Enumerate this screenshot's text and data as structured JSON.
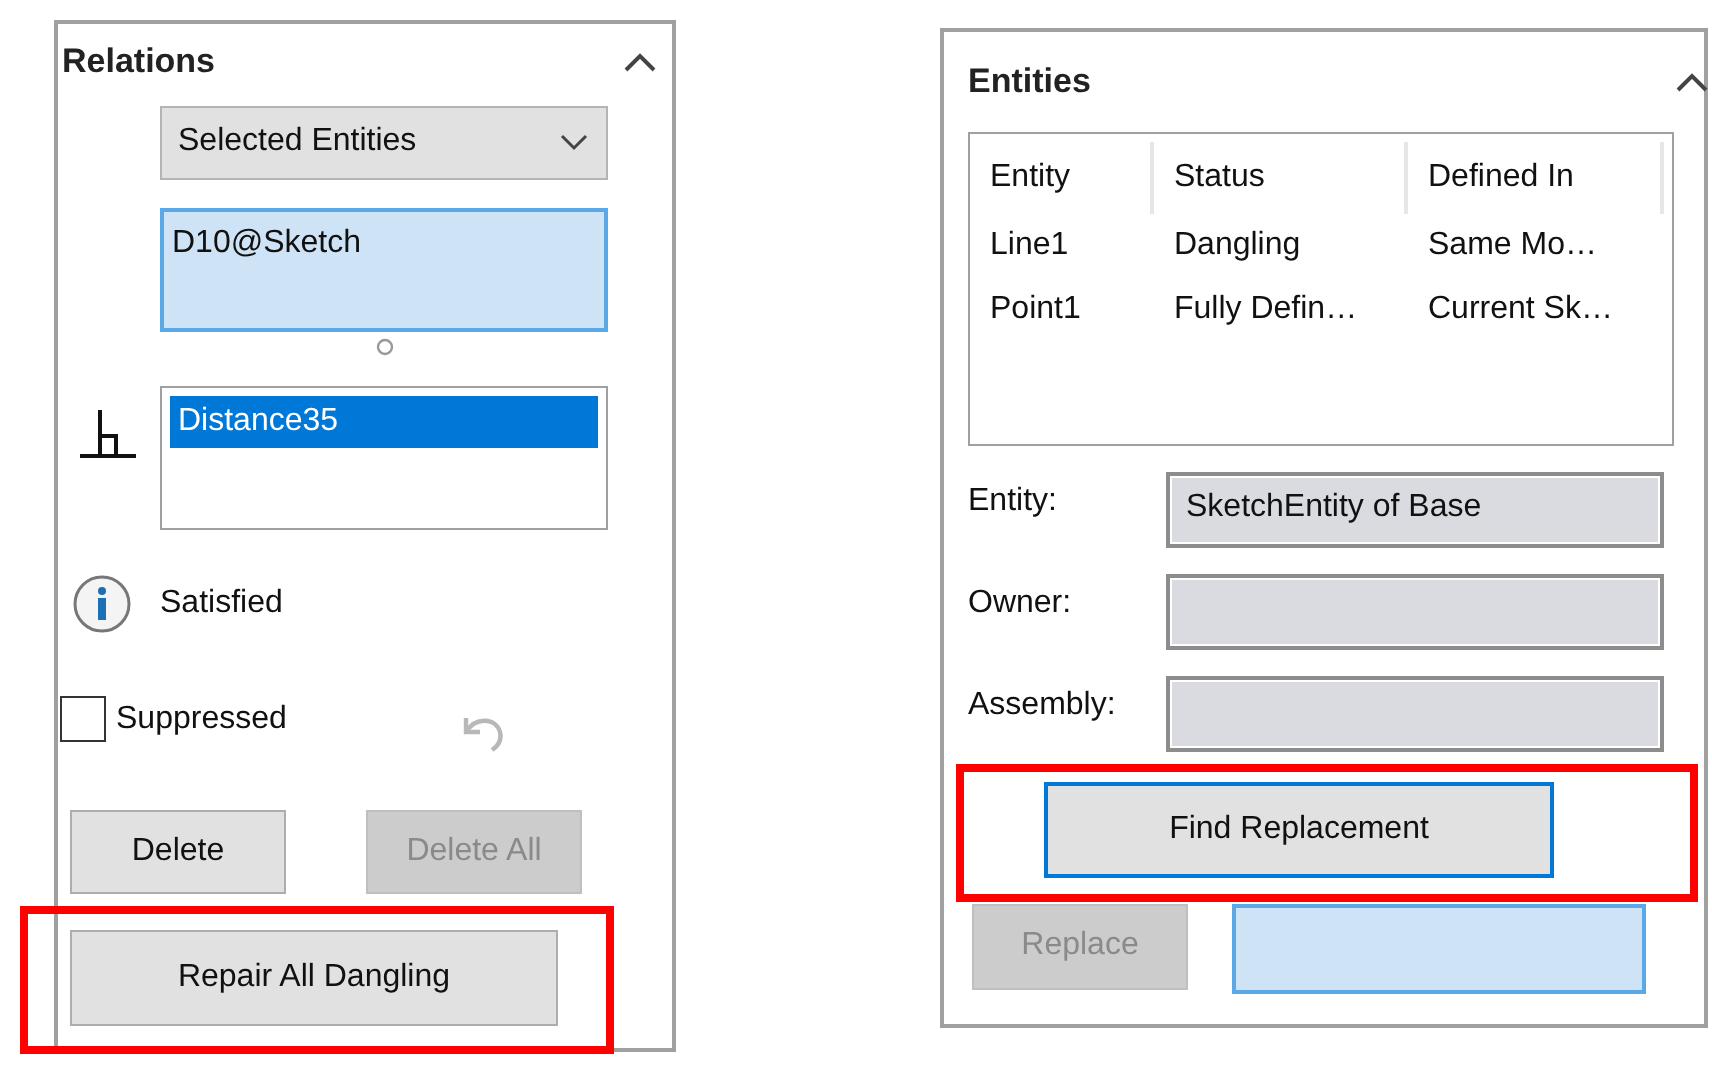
{
  "relations_panel": {
    "title": "Relations",
    "expanded": true,
    "filter_dropdown": {
      "value": "Selected Entities"
    },
    "entities_list": {
      "items": [
        "D10@Sketch"
      ]
    },
    "relations_list": {
      "items": [
        {
          "label": "Distance35",
          "selected": true
        }
      ]
    },
    "status": "Satisfied",
    "suppressed": {
      "label": "Suppressed",
      "checked": false
    },
    "buttons": [
      {
        "label": "Delete",
        "disabled": false
      },
      {
        "label": "Delete All",
        "disabled": true
      }
    ],
    "repair_button": {
      "label": "Repair All Dangling",
      "highlighted": true
    }
  },
  "entities_panel": {
    "title": "Entities",
    "expanded": true,
    "table": {
      "columns": [
        "Entity",
        "Status",
        "Defined In"
      ],
      "rows": [
        [
          "Line1",
          "Dangling",
          "Same Mo…"
        ],
        [
          "Point1",
          "Fully Defin…",
          "Current Sk…"
        ]
      ]
    },
    "fields": [
      {
        "label": "Entity:",
        "value": "SketchEntity of Base"
      },
      {
        "label": "Owner:"
      },
      {
        "label": "Assembly:"
      }
    ],
    "find_button": {
      "label": "Find Replacement",
      "highlighted": true
    },
    "replace_button": {
      "label": "Replace",
      "disabled": true
    }
  }
}
